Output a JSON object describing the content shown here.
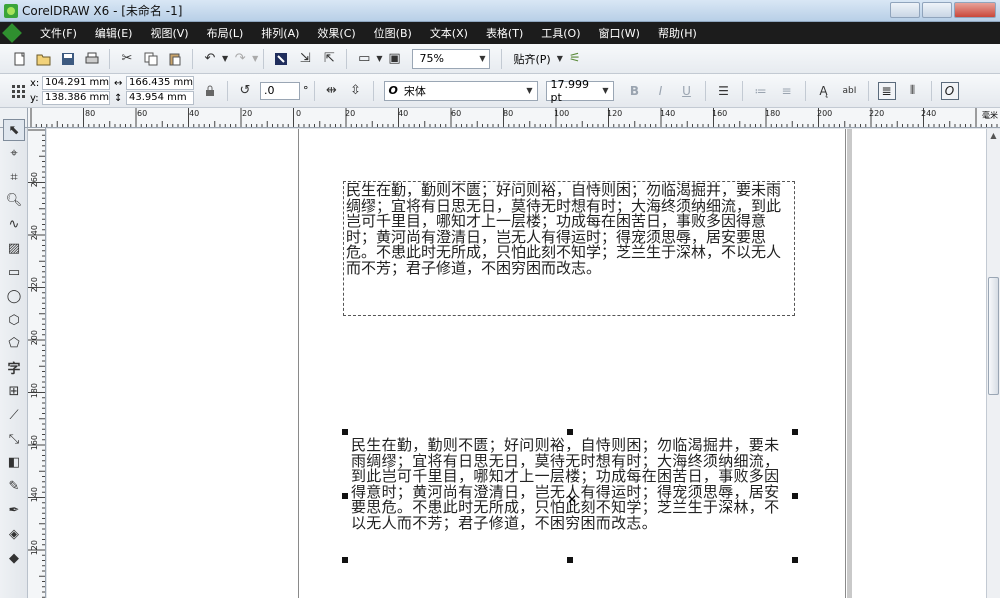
{
  "window": {
    "title": "CorelDRAW X6 - [未命名 -1]"
  },
  "menubar": {
    "items": [
      "文件(F)",
      "编辑(E)",
      "视图(V)",
      "布局(L)",
      "排列(A)",
      "效果(C)",
      "位图(B)",
      "文本(X)",
      "表格(T)",
      "工具(O)",
      "窗口(W)",
      "帮助(H)"
    ]
  },
  "toolbar": {
    "zoom": "75%",
    "snap_label": "贴齐(P)"
  },
  "propertybar": {
    "x_label": "x:",
    "x_value": "104.291 mm",
    "y_label": "y:",
    "y_value": "138.386 mm",
    "width_value": "166.435 mm",
    "height_value": "43.954 mm",
    "angle_value": ".0",
    "angle_unit": "°",
    "font_name": "宋体",
    "font_size": "17.999 pt",
    "font_icon_letter": "O",
    "text_icon_letter": "O"
  },
  "ruler": {
    "unit": "毫米",
    "h_ticks": [
      "80",
      "60",
      "40",
      "20",
      "0",
      "20",
      "40",
      "60",
      "80",
      "100",
      "120",
      "140",
      "160",
      "180",
      "200",
      "220",
      "240"
    ],
    "v_ticks": [
      "260",
      "240",
      "220",
      "200",
      "180",
      "160",
      "140",
      "120"
    ]
  },
  "document": {
    "paragraph_text": "民生在勤，勤则不匮；好问则裕，自恃则困；勿临渴掘井，要未雨绸缪；宜将有日思无日，莫待无时想有时；大海终须纳细流，到此岂可千里目，哪知才上一层楼；功成每在困苦日，事败多因得意时；黄河尚有澄清日，岂无人有得运时；得宠须思辱，居安要思危。不患此时无所成，只怕此刻不知学；芝兰生于深林，不以无人而不芳；君子修道，不困穷困而改志。",
    "artistic_text": "民生在勤，勤则不匮；好问则裕，自恃则困；勿临渴掘井，要未雨绸缪；宜将有日思无日，莫待无时想有时；大海终须纳细流，到此岂可千里目，哪知才上一层楼；功成每在困苦日，事败多因得意时；黄河尚有澄清日，岂无人有得运时；得宠须思辱，居安要思危。不患此时无所成，只怕此刻不知学；芝兰生于深林，不以无人而不芳；君子修道，不困穷困而改志。"
  }
}
